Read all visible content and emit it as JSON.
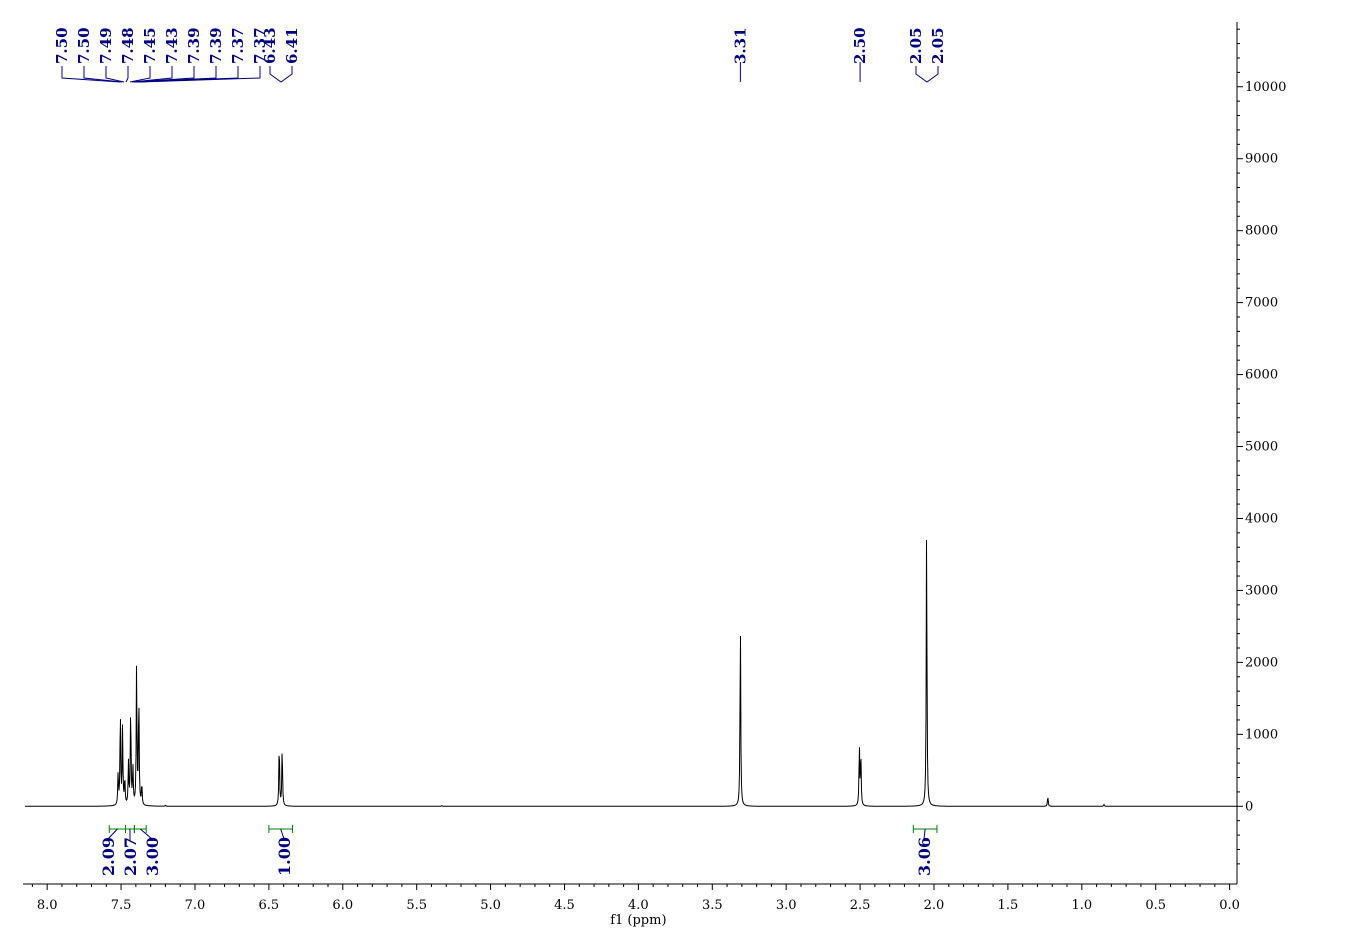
{
  "chart_data": {
    "type": "line",
    "title": "",
    "xlabel": "f1 (ppm)",
    "ylabel": "",
    "xlim": [
      8.15,
      -0.05
    ],
    "ylim": [
      -1080,
      10900
    ],
    "x_reversed": true,
    "grid": false,
    "x_ticks": [
      "8.0",
      "7.5",
      "7.0",
      "6.5",
      "6.0",
      "5.5",
      "5.0",
      "4.5",
      "4.0",
      "3.5",
      "3.0",
      "2.5",
      "2.0",
      "1.5",
      "1.0",
      "0.5",
      "0.0"
    ],
    "y_ticks": [
      "0",
      "1000",
      "2000",
      "3000",
      "4000",
      "5000",
      "6000",
      "7000",
      "8000",
      "9000",
      "10000"
    ],
    "series": [
      {
        "peaks": [
          {
            "x": 7.52,
            "y": 450
          },
          {
            "x": 7.505,
            "y": 1330
          },
          {
            "x": 7.49,
            "y": 1080
          },
          {
            "x": 7.475,
            "y": 380
          },
          {
            "x": 7.45,
            "y": 590
          },
          {
            "x": 7.435,
            "y": 1400
          },
          {
            "x": 7.42,
            "y": 530
          },
          {
            "x": 7.395,
            "y": 1980
          },
          {
            "x": 7.38,
            "y": 1570
          },
          {
            "x": 7.36,
            "y": 300
          },
          {
            "x": 6.43,
            "y": 890
          },
          {
            "x": 6.41,
            "y": 850
          },
          {
            "x": 3.31,
            "y": 2580
          },
          {
            "x": 2.505,
            "y": 850
          },
          {
            "x": 2.495,
            "y": 700
          },
          {
            "x": 2.05,
            "y": 3960
          },
          {
            "x": 1.23,
            "y": 140
          },
          {
            "x": 0.85,
            "y": 25
          },
          {
            "x": 5.33,
            "y": 12
          },
          {
            "x": 7.2,
            "y": 12
          }
        ]
      }
    ],
    "peak_labels": [
      "7.50",
      "7.50",
      "7.49",
      "7.48",
      "7.45",
      "7.43",
      "7.39",
      "7.39",
      "7.37",
      "7.37",
      "6.43",
      "6.41",
      "3.31",
      "2.50",
      "2.05",
      "2.05"
    ],
    "integrations": [
      {
        "label": "2.09",
        "from": 7.58,
        "to": 7.47
      },
      {
        "label": "2.07",
        "from": 7.47,
        "to": 7.41
      },
      {
        "label": "3.00",
        "from": 7.41,
        "to": 7.33
      },
      {
        "label": "1.00",
        "from": 6.5,
        "to": 6.34
      },
      {
        "label": "3.06",
        "from": 2.14,
        "to": 1.98
      }
    ],
    "colors": {
      "spectrum": "#000000",
      "peak_labels": "#000080",
      "integrals": "#008000"
    }
  }
}
